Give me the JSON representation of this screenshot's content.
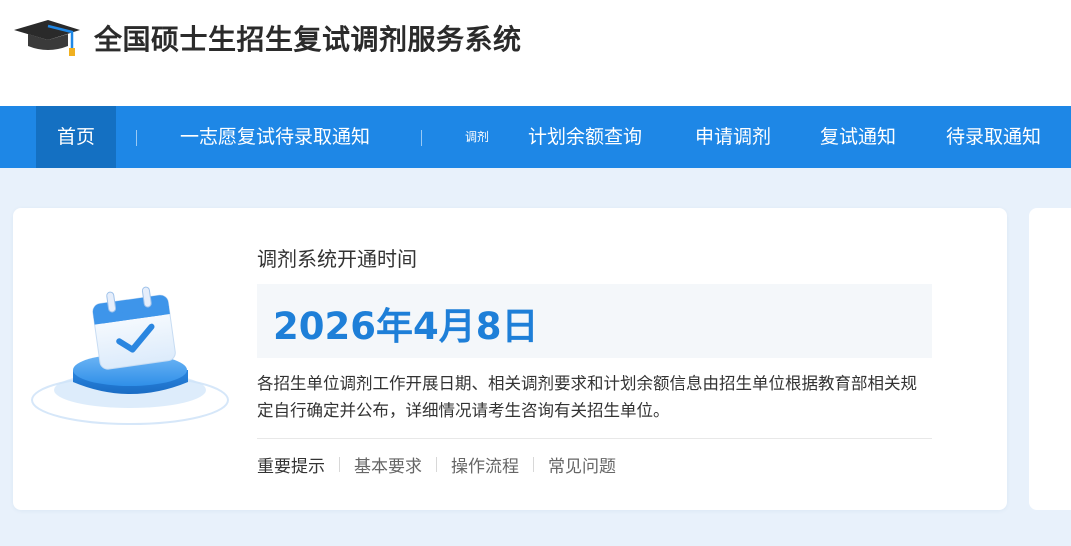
{
  "header": {
    "logo_icon": "graduation-cap-icon",
    "title": "全国硕士生招生复试调剂服务系统"
  },
  "nav": {
    "items": [
      {
        "label": "首页",
        "active": true
      },
      {
        "label": "一志愿复试待录取通知",
        "active": false
      },
      {
        "label": "计划余额查询",
        "active": false
      },
      {
        "label": "申请调剂",
        "active": false
      },
      {
        "label": "复试通知",
        "active": false
      },
      {
        "label": "待录取通知",
        "active": false
      }
    ],
    "tag": "调剂"
  },
  "card": {
    "illustration_icon": "calendar-check-icon",
    "open_label": "调剂系统开通时间",
    "date": "2026年4月8日",
    "description": "各招生单位调剂工作开展日期、相关调剂要求和计划余额信息由招生单位根据教育部相关规定自行确定并公布，详细情况请考生咨询有关招生单位。",
    "links": [
      "重要提示",
      "基本要求",
      "操作流程",
      "常见问题"
    ]
  },
  "colors": {
    "nav_bg": "#1e87e6",
    "nav_active": "#1470c2",
    "accent": "#1e7fd8",
    "page_bg": "#e8f1fb"
  }
}
